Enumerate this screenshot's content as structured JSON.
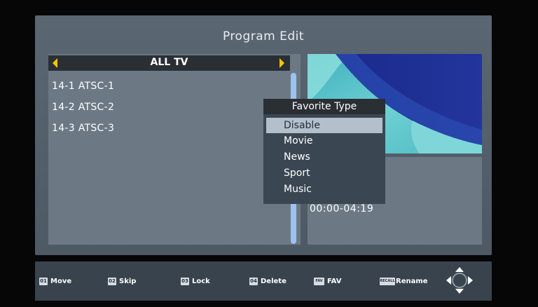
{
  "screen": {
    "title": "Program Edit"
  },
  "channel_list": {
    "group": "ALL TV",
    "channels": [
      "14-1 ATSC-1",
      "14-2 ATSC-2",
      "14-3 ATSC-3"
    ]
  },
  "info": {
    "duration": "00:00-04:19"
  },
  "favorite_popup": {
    "title": "Favorite Type",
    "options": [
      "Disable",
      "Movie",
      "News",
      "Sport",
      "Music"
    ],
    "selected": "Disable"
  },
  "footer": {
    "keys": [
      {
        "badge": "01",
        "label": "Move"
      },
      {
        "badge": "02",
        "label": "Skip"
      },
      {
        "badge": "03",
        "label": "Lock"
      },
      {
        "badge": "04",
        "label": "Delete"
      },
      {
        "badge": "FAV",
        "label": "FAV"
      },
      {
        "badge": "RECALL",
        "label": "Rename"
      }
    ],
    "nav_icon": "dpad-icon"
  },
  "colors": {
    "accent_arrow": "#ffc600",
    "panel": "#56626d",
    "selection": "#b3bfca",
    "scrollbar": "#9ec2ee"
  }
}
